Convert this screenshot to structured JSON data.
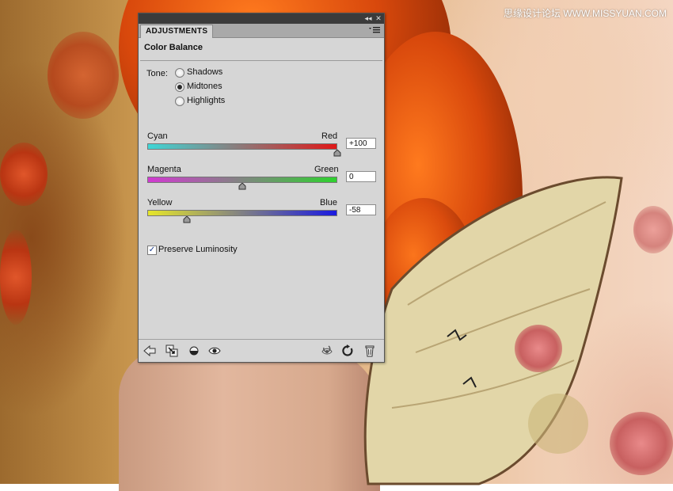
{
  "watermark": "思缘设计论坛 WWW.MISSYUAN.COM",
  "panel": {
    "tab_label": "ADJUSTMENTS",
    "title": "Color Balance",
    "tone_label": "Tone:",
    "tones": [
      {
        "label": "Shadows",
        "selected": false
      },
      {
        "label": "Midtones",
        "selected": true
      },
      {
        "label": "Highlights",
        "selected": false
      }
    ],
    "sliders": [
      {
        "left": "Cyan",
        "right": "Red",
        "value": "+100",
        "level": 100,
        "from": "#3fd6d6",
        "to": "#e01818"
      },
      {
        "left": "Magenta",
        "right": "Green",
        "value": "0",
        "level": 0,
        "from": "#d23ad2",
        "to": "#2ed22e"
      },
      {
        "left": "Yellow",
        "right": "Blue",
        "value": "-58",
        "level": -58,
        "from": "#e6e62a",
        "to": "#1a1ae0"
      }
    ],
    "preserve_luminosity": {
      "label": "Preserve Luminosity",
      "checked": true
    },
    "bottom_icons": [
      "back-arrow-icon",
      "clip-to-layer-icon",
      "view-previous-icon",
      "visibility-eye-icon",
      "view-previous-state-icon",
      "reset-icon",
      "trash-icon"
    ]
  }
}
